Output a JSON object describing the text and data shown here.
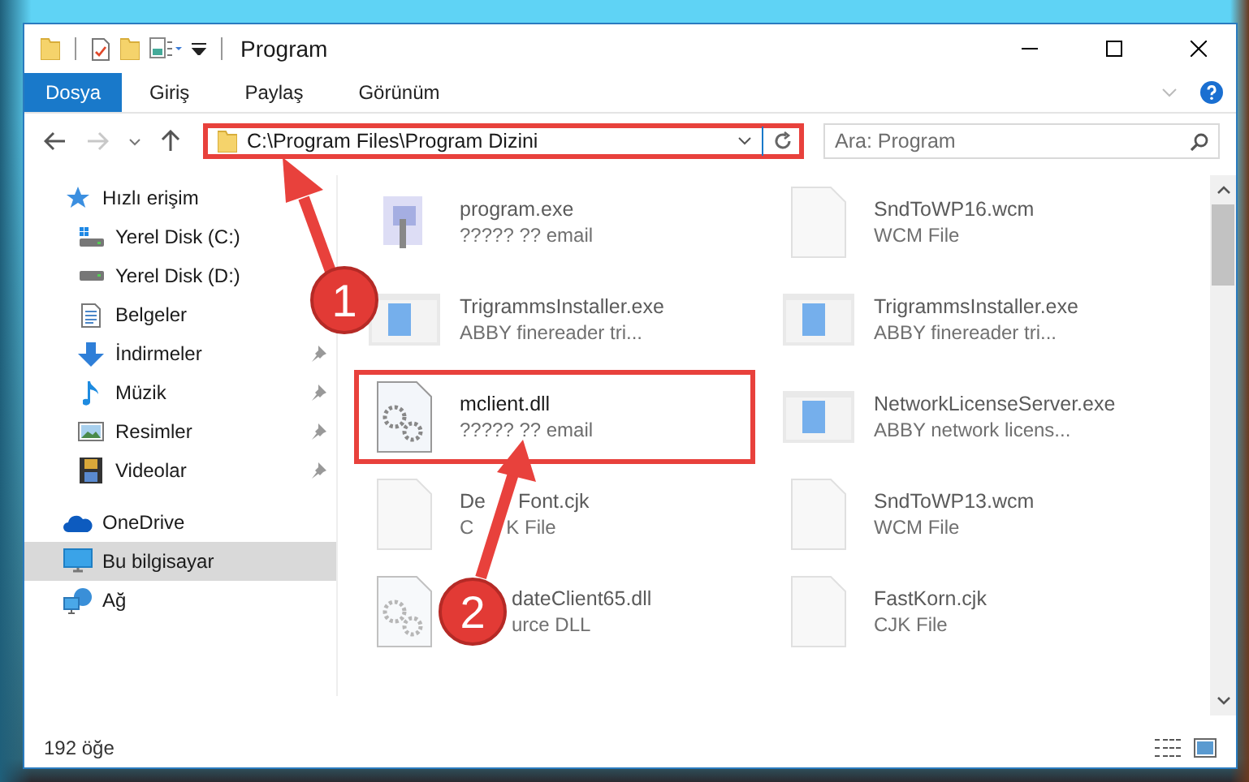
{
  "window": {
    "title": "Program"
  },
  "ribbon_tabs": [
    {
      "label": "Dosya",
      "selected": true
    },
    {
      "label": "Giriş",
      "selected": false
    },
    {
      "label": "Paylaş",
      "selected": false
    },
    {
      "label": "Görünüm",
      "selected": false
    }
  ],
  "address": {
    "path": "C:\\Program Files\\Program Dizini",
    "highlighted": true
  },
  "search": {
    "placeholder": "Ara: Program"
  },
  "sidebar": {
    "items": [
      {
        "label": "Hızlı erişim",
        "kind": "star",
        "selected": false,
        "children": [
          {
            "label": "Yerel Disk (C:)",
            "kind": "system-drive",
            "selected": false,
            "pinned": false
          },
          {
            "label": "Yerel Disk (D:)",
            "kind": "drive",
            "selected": false,
            "pinned": false
          },
          {
            "label": "Belgeler",
            "kind": "documents",
            "selected": false,
            "pinned": false
          },
          {
            "label": "İndirmeler",
            "kind": "downloads",
            "selected": false,
            "pinned": true
          },
          {
            "label": "Müzik",
            "kind": "music",
            "selected": false,
            "pinned": true
          },
          {
            "label": "Resimler",
            "kind": "pictures",
            "selected": false,
            "pinned": true
          },
          {
            "label": "Videolar",
            "kind": "videos",
            "selected": false,
            "pinned": true
          }
        ]
      },
      {
        "label": "OneDrive",
        "kind": "cloud",
        "selected": false
      },
      {
        "label": "Bu bilgisayar",
        "kind": "computer",
        "selected": true
      },
      {
        "label": "Ağ",
        "kind": "network",
        "selected": false
      }
    ]
  },
  "files": [
    {
      "name": [
        "program.exe"
      ],
      "type": [
        "????? ?? email"
      ],
      "kind": "program",
      "faded": true,
      "highlighted": false
    },
    {
      "name": [
        "SndToWP16.wcm"
      ],
      "type": [
        "WCM File"
      ],
      "kind": "blank",
      "faded": true,
      "highlighted": false
    },
    {
      "name": [
        "TrigrammsInstaller.exe"
      ],
      "type": [
        "ABBY finereader tri..."
      ],
      "kind": "app",
      "faded": true,
      "highlighted": false
    },
    {
      "name": [
        "TrigrammsInstaller.exe"
      ],
      "type": [
        "ABBY finereader tri..."
      ],
      "kind": "app",
      "faded": true,
      "highlighted": false
    },
    {
      "name": [
        "mclient.dll"
      ],
      "type": [
        "????? ?? email"
      ],
      "kind": "dll",
      "faded": false,
      "highlighted": true
    },
    {
      "name": [
        "NetworkLicenseServer.exe"
      ],
      "type": [
        "ABBY network licens..."
      ],
      "kind": "app",
      "faded": true,
      "highlighted": false
    },
    {
      "name": [
        "De",
        "Font.cjk"
      ],
      "type": [
        "C",
        "K File"
      ],
      "kind": "blank",
      "faded": true,
      "highlighted": false
    },
    {
      "name": [
        "SndToWP13.wcm"
      ],
      "type": [
        "WCM File"
      ],
      "kind": "blank",
      "faded": true,
      "highlighted": false
    },
    {
      "name": [
        "dateClient65.dll"
      ],
      "type": [
        "urce DLL"
      ],
      "kind": "dll",
      "faded": true,
      "highlighted": false,
      "indent": true
    },
    {
      "name": [
        "FastKorn.cjk"
      ],
      "type": [
        "CJK File"
      ],
      "kind": "blank",
      "faded": true,
      "highlighted": false
    }
  ],
  "status_bar": {
    "count": "192 öğe"
  },
  "annotations": [
    {
      "number": "1"
    },
    {
      "number": "2"
    }
  ]
}
